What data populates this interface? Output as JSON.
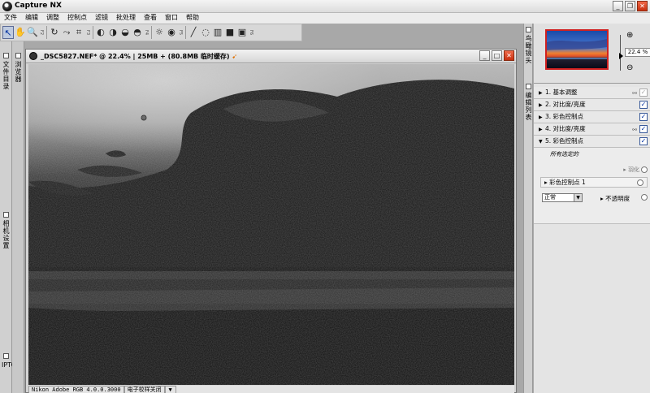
{
  "app": {
    "title": "Capture NX"
  },
  "menu": [
    "文件",
    "编辑",
    "调整",
    "控制点",
    "滤镜",
    "批处理",
    "查看",
    "窗口",
    "帮助"
  ],
  "toolbar": {
    "f2": "F2",
    "f3": "F3",
    "f4": "F4",
    "f5": "F5",
    "f6": "F6"
  },
  "left_dock": {
    "tab_files": "文件目录",
    "tab_browser": "浏览器",
    "tab_camera": "相机设置",
    "tab_iptc": "IPTC"
  },
  "document": {
    "title": "_DSC5827.NEF* @ 22.4% | 25MB + (80.8MB 临时缓存)",
    "status_profile": "Nikon Adobe RGB 4.0.0.3000",
    "status_mode": "电子校样关闭",
    "status_arrow": "▼"
  },
  "right": {
    "birdseye_tab": "鸟瞰镜头",
    "editlist_tab": "编辑列表",
    "zoom_value": "22.4 %"
  },
  "edit_list": {
    "steps": [
      {
        "label": "1. 基本调整",
        "checked": true
      },
      {
        "label": "2. 对比度/亮度",
        "checked": true
      },
      {
        "label": "3. 彩色控制点",
        "checked": true
      },
      {
        "label": "4. 对比度/亮度",
        "checked": true
      },
      {
        "label": "5. 彩色控制点",
        "checked": true
      }
    ],
    "selected_all": "所有选定的",
    "feather": "羽化",
    "color_control_point": "彩色控制点 1",
    "blend_mode": "正常",
    "opacity": "不透明度"
  },
  "colors": {
    "accent_check": "#0030a0",
    "close_red": "#c83010",
    "thumb_border": "#d02020"
  }
}
